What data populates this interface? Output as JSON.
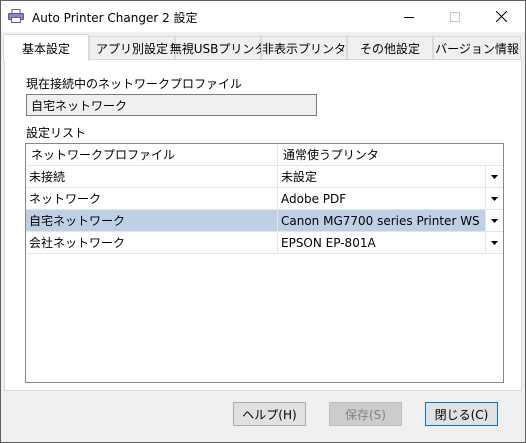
{
  "window": {
    "title": "Auto Printer Changer 2 設定"
  },
  "tabs": [
    {
      "label": "基本設定",
      "active": true
    },
    {
      "label": "アプリ別設定",
      "active": false
    },
    {
      "label": "無視USBプリンタ",
      "active": false
    },
    {
      "label": "非表示プリンタ",
      "active": false
    },
    {
      "label": "その他設定",
      "active": false
    },
    {
      "label": "バージョン情報",
      "active": false
    }
  ],
  "current_profile": {
    "label": "現在接続中のネットワークプロファイル",
    "value": "自宅ネットワーク"
  },
  "settings": {
    "label": "設定リスト",
    "columns": [
      "ネットワークプロファイル",
      "通常使うプリンタ"
    ],
    "rows": [
      {
        "profile": "未接続",
        "printer": "未設定",
        "selected": false
      },
      {
        "profile": "ネットワーク",
        "printer": "Adobe PDF",
        "selected": false
      },
      {
        "profile": "自宅ネットワーク",
        "printer": "Canon MG7700 series Printer WS",
        "selected": true
      },
      {
        "profile": "会社ネットワーク",
        "printer": "EPSON EP-801A",
        "selected": false
      }
    ]
  },
  "buttons": {
    "help": "ヘルプ(H)",
    "save": "保存(S)",
    "close": "閉じる(C)"
  },
  "colors": {
    "selected_row": "#bfd0e6",
    "focus_border": "#0078d7"
  }
}
